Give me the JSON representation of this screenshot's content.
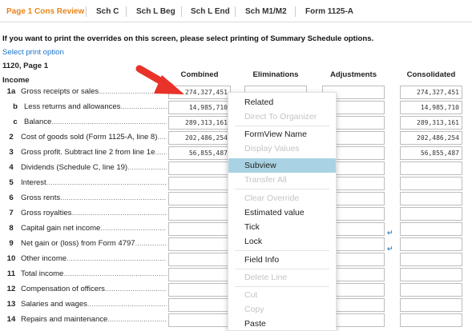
{
  "tabs": [
    {
      "label": "Page 1 Cons Review",
      "active": true
    },
    {
      "label": "Sch C"
    },
    {
      "label": "Sch L Beg"
    },
    {
      "label": "Sch L End"
    },
    {
      "label": "Sch M1/M2"
    },
    {
      "label": "Form 1125-A"
    }
  ],
  "notice": "If you want to print the overrides on this screen, please select printing of Summary Schedule options.",
  "print_link": "Select print option",
  "section_title": "1120, Page 1",
  "subsection": "Income",
  "columns": [
    "Combined",
    "Eliminations",
    "Adjustments",
    "Consolidated"
  ],
  "rows": [
    {
      "line": "1a",
      "label": "Gross receipts or sales",
      "combined": "274,327,451",
      "eliminations": "",
      "adjustments": "",
      "consolidated": "274,327,451"
    },
    {
      "line": "b",
      "label": "Less returns and allowances",
      "combined": "14,985,710",
      "eliminations": "",
      "adjustments": "",
      "consolidated": "14,985,710"
    },
    {
      "line": "c",
      "label": "Balance",
      "combined": "289,313,161",
      "eliminations": "",
      "adjustments": "",
      "consolidated": "289,313,161"
    },
    {
      "line": "2",
      "label": "Cost of goods sold (Form 1125-A, line 8)",
      "combined": "202,486,254",
      "eliminations": "",
      "adjustments": "",
      "consolidated": "202,486,254"
    },
    {
      "line": "3",
      "label": "Gross profit. Subtract line 2 from line 1e",
      "combined": "56,855,487",
      "eliminations": "",
      "adjustments": "",
      "consolidated": "56,855,487"
    },
    {
      "line": "4",
      "label": "Dividends (Schedule C, line 19)",
      "combined": "",
      "eliminations": "",
      "adjustments": "",
      "consolidated": ""
    },
    {
      "line": "5",
      "label": "Interest",
      "combined": "",
      "eliminations": "",
      "adjustments": "",
      "consolidated": ""
    },
    {
      "line": "6",
      "label": "Gross rents",
      "combined": "",
      "eliminations": "",
      "adjustments": "",
      "consolidated": ""
    },
    {
      "line": "7",
      "label": "Gross royalties",
      "combined": "",
      "eliminations": "",
      "adjustments": "",
      "consolidated": ""
    },
    {
      "line": "8",
      "label": "Capital gain net income",
      "combined": "",
      "eliminations": "",
      "adjustments": "",
      "consolidated": ""
    },
    {
      "line": "9",
      "label": "Net gain or (loss) from Form 4797",
      "combined": "",
      "eliminations": "",
      "adjustments": "",
      "consolidated": ""
    },
    {
      "line": "10",
      "label": "Other income",
      "combined": "",
      "eliminations": "",
      "adjustments": "",
      "consolidated": ""
    },
    {
      "line": "11",
      "label": "Total income",
      "combined": "",
      "eliminations": "",
      "adjustments": "",
      "consolidated": ""
    },
    {
      "line": "12",
      "label": "Compensation of officers",
      "combined": "",
      "eliminations": "",
      "adjustments": "",
      "consolidated": ""
    },
    {
      "line": "13",
      "label": "Salaries and wages",
      "combined": "",
      "eliminations": "",
      "adjustments": "",
      "consolidated": ""
    },
    {
      "line": "14",
      "label": "Repairs and maintenance",
      "combined": "",
      "eliminations": "",
      "adjustments": "",
      "consolidated": ""
    }
  ],
  "context_menu": {
    "items": [
      {
        "label": "Related",
        "enabled": true
      },
      {
        "label": "Direct To Organizer",
        "enabled": false
      },
      {
        "label": "FormView Name",
        "enabled": true
      },
      {
        "label": "Display Values",
        "enabled": false
      },
      {
        "label": "Subview",
        "enabled": true,
        "selected": true
      },
      {
        "label": "Transfer All",
        "enabled": false
      },
      {
        "label": "Clear Override",
        "enabled": false
      },
      {
        "label": "Estimated value",
        "enabled": true
      },
      {
        "label": "Tick",
        "enabled": true
      },
      {
        "label": "Lock",
        "enabled": true
      },
      {
        "label": "Field Info",
        "enabled": true
      },
      {
        "label": "Delete Line",
        "enabled": false
      },
      {
        "label": "Cut",
        "enabled": false
      },
      {
        "label": "Copy",
        "enabled": false
      },
      {
        "label": "Paste",
        "enabled": true
      }
    ]
  },
  "colors": {
    "active_tab": "#e8851b",
    "link": "#1a73c8",
    "menu_highlight": "#a9d3e4",
    "pointer_arrow": "#e8322a"
  },
  "annotation_icon": "pointer-arrow-icon"
}
